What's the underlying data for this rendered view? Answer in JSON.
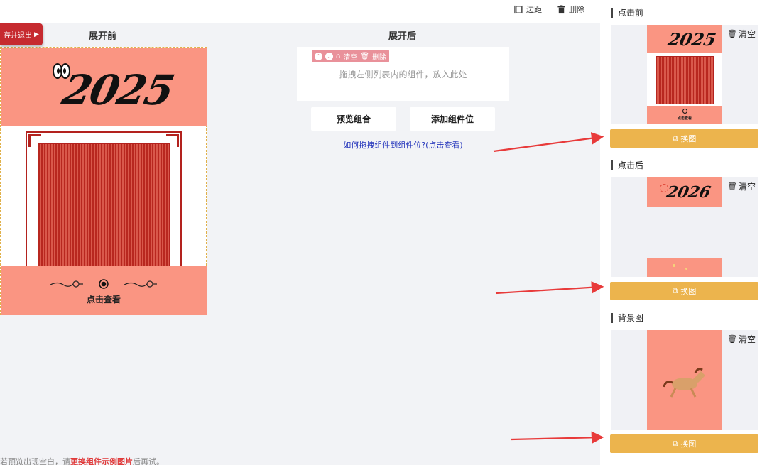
{
  "toolbar": {
    "margin_label": "边距",
    "delete_label": "删除"
  },
  "save_exit": "存并退出",
  "columns": {
    "before_title": "展开前",
    "after_title": "展开后"
  },
  "canvas": {
    "year": "2025",
    "cta": "点击查看"
  },
  "drop_zone": {
    "toolbar": {
      "clear": "清空",
      "delete": "删除"
    },
    "hint": "拖拽左侧列表内的组件，放入此处"
  },
  "buttons": {
    "preview": "预览组合",
    "add_slot": "添加组件位"
  },
  "help_link": "如何拖拽组件到组件位?(点击查看)",
  "bottom_tip": {
    "prefix": "若预览出现空白，请",
    "highlight": "更换组件示例图片",
    "suffix": "后再试。"
  },
  "panel": {
    "sections": [
      {
        "title": "点击前",
        "clear": "清空",
        "swap": "换图",
        "thumb_year": "2025",
        "thumb_cta": "点击查看"
      },
      {
        "title": "点击后",
        "clear": "清空",
        "swap": "换图",
        "thumb_year": "2026"
      },
      {
        "title": "背景图",
        "clear": "清空",
        "swap": "换图"
      }
    ]
  },
  "colors": {
    "salmon": "#fa9582",
    "red": "#c62a2f",
    "gold": "#ecb44d",
    "link": "#2233bb",
    "arrow": "#e83a3a"
  }
}
